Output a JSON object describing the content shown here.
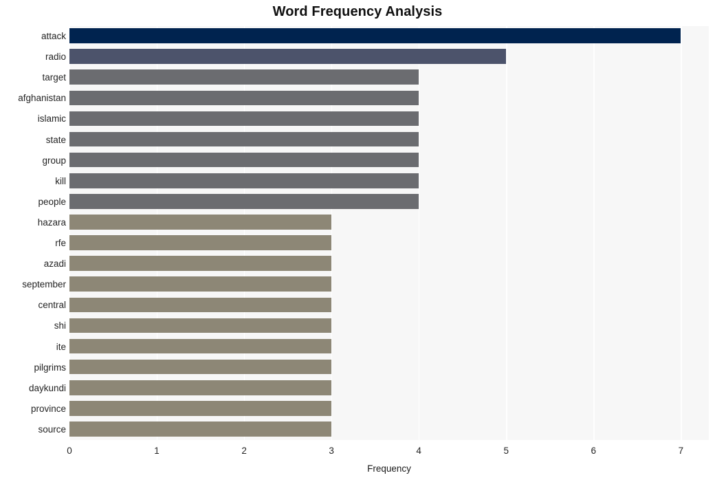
{
  "chart_data": {
    "type": "bar",
    "orientation": "horizontal",
    "title": "Word Frequency Analysis",
    "xlabel": "Frequency",
    "ylabel": "",
    "categories": [
      "attack",
      "radio",
      "target",
      "afghanistan",
      "islamic",
      "state",
      "group",
      "kill",
      "people",
      "hazara",
      "rfe",
      "azadi",
      "september",
      "central",
      "shi",
      "ite",
      "pilgrims",
      "daykundi",
      "province",
      "source"
    ],
    "values": [
      7,
      5,
      4,
      4,
      4,
      4,
      4,
      4,
      4,
      3,
      3,
      3,
      3,
      3,
      3,
      3,
      3,
      3,
      3,
      3
    ],
    "bar_colors": [
      "#00234f",
      "#4c536b",
      "#6b6c70",
      "#6b6c70",
      "#6b6c70",
      "#6b6c70",
      "#6b6c70",
      "#6b6c70",
      "#6b6c70",
      "#8d8776",
      "#8d8776",
      "#8d8776",
      "#8d8776",
      "#8d8776",
      "#8d8776",
      "#8d8776",
      "#8d8776",
      "#8d8776",
      "#8d8776",
      "#8d8776"
    ],
    "xlim": [
      0,
      7.32
    ],
    "xticks": [
      0,
      1,
      2,
      3,
      4,
      5,
      6,
      7
    ],
    "xtick_labels": [
      "0",
      "1",
      "2",
      "3",
      "4",
      "5",
      "6",
      "7"
    ],
    "grid": true,
    "grid_axis": "x",
    "grid_color": "#ffffff",
    "plot_background": "#f7f7f7",
    "figure_background": "#ffffff",
    "legend": null
  }
}
